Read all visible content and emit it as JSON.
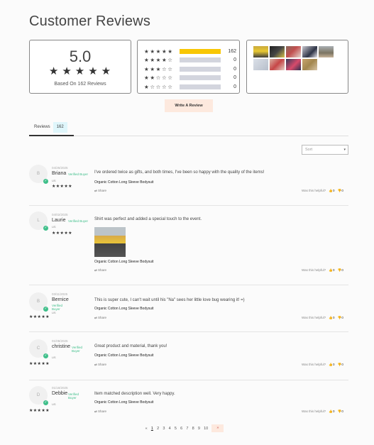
{
  "header": {
    "title": "Customer Reviews"
  },
  "summary": {
    "average": "5.0",
    "average_stars": "★★★★★",
    "based_on": "Based On 162 Reviews"
  },
  "distribution": [
    {
      "stars": "★★★★★",
      "count": "162",
      "fraction": 1.0
    },
    {
      "stars": "★★★★☆",
      "count": "0",
      "fraction": 0
    },
    {
      "stars": "★★★☆☆",
      "count": "0",
      "fraction": 0
    },
    {
      "stars": "★★☆☆☆",
      "count": "0",
      "fraction": 0
    },
    {
      "stars": "★☆☆☆☆",
      "count": "0",
      "fraction": 0
    }
  ],
  "write_review_label": "Write A Review",
  "tabs": [
    {
      "label": "Reviews",
      "count": "162"
    }
  ],
  "sort": {
    "placeholder": "Sort",
    "caret": "▾"
  },
  "reviews": [
    {
      "avatar": "B",
      "date": "04/26/2025",
      "name": "Briana",
      "badge": "Verified Buyer",
      "location": "US",
      "stars": "★★★★★",
      "body": "I've ordered twice as gifts, and both times, I've been so happy with the quality of the items!",
      "product": "Organic Cotton Long Sleeve Bodysuit",
      "share": "Share",
      "helpful": "Was this helpful?",
      "up": "0",
      "down": "0"
    },
    {
      "avatar": "L",
      "date": "04/02/2025",
      "name": "Laurie",
      "badge": "Verified Buyer",
      "location": "US",
      "stars": "★★★★★",
      "body": "Shirt was perfect and added a special touch to the event.",
      "product": "Organic Cotton Long Sleeve Bodysuit",
      "share": "Share",
      "helpful": "Was this helpful?",
      "up": "0",
      "down": "0"
    },
    {
      "avatar": "B",
      "date": "03/11/2025",
      "name": "Bernice",
      "badge": "Verified Buyer",
      "location": "US",
      "stars": "★★★★★",
      "body": "This is super cute, I can't wait until his \"Na\" sees her little love bug wearing it! =)",
      "product": "Organic Cotton Long Sleeve Bodysuit",
      "share": "Share",
      "helpful": "Was this helpful?",
      "up": "0",
      "down": "0"
    },
    {
      "avatar": "C",
      "date": "01/08/2025",
      "name": "christine",
      "badge": "Verified Buyer",
      "location": "US",
      "stars": "★★★★★",
      "body": "Great product and material, thank you!",
      "product": "Organic Cotton Long Sleeve Bodysuit",
      "share": "Share",
      "helpful": "Was this helpful?",
      "up": "0",
      "down": "0"
    },
    {
      "avatar": "D",
      "date": "01/18/2025",
      "name": "Debbie",
      "badge": "Verified Buyer",
      "location": "US",
      "stars": "★★★★★",
      "body": "Item matched description well. Very happy.",
      "product": "Organic Cotton Long Sleeve Bodysuit",
      "share": "Share",
      "helpful": "Was this helpful?",
      "up": "0",
      "down": "0"
    }
  ],
  "pagination": {
    "prev": "«",
    "pages": [
      "1",
      "2",
      "3",
      "4",
      "5",
      "6",
      "7",
      "8",
      "9",
      "10"
    ],
    "current": "1",
    "next": "»"
  },
  "icons": {
    "thumbs_up": "👍",
    "thumbs_down": "👎",
    "share": "⇄",
    "check": "✓"
  },
  "colors": {
    "bar_fill": "#f8c705",
    "verified": "#3fbf8a",
    "button_bg": "#fde9de"
  }
}
